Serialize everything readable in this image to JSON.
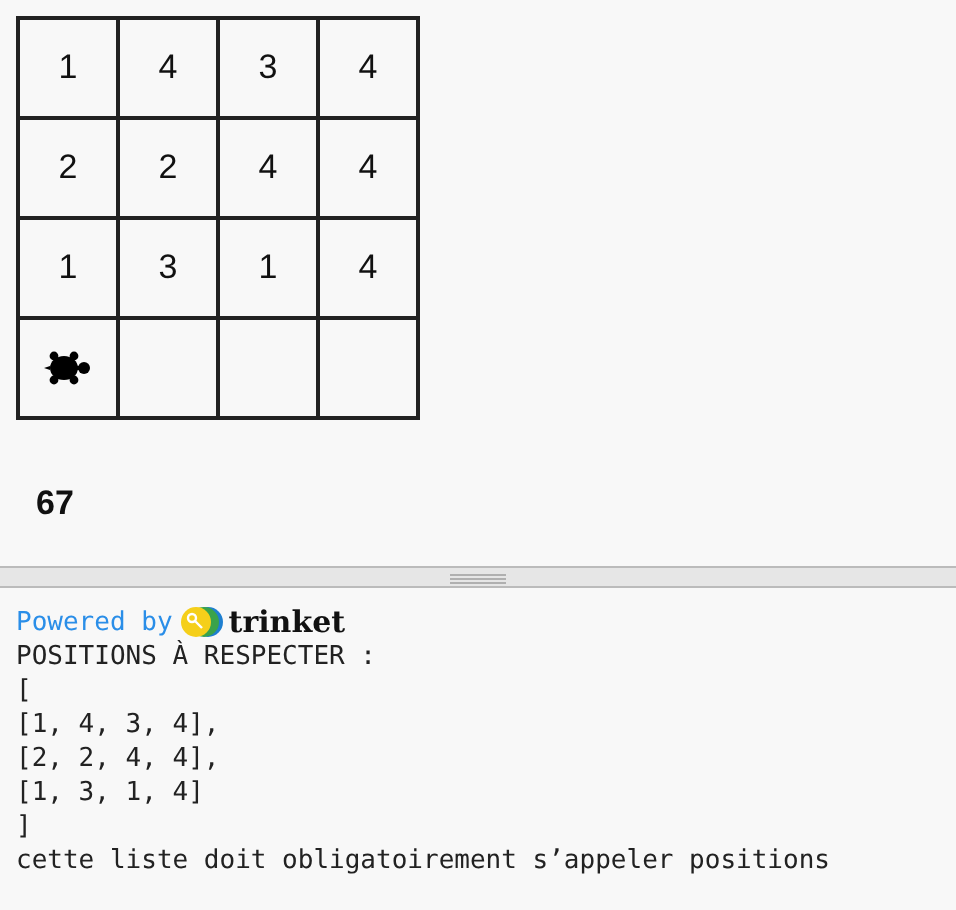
{
  "grid": {
    "rows": [
      [
        {
          "kind": "number",
          "text": "1"
        },
        {
          "kind": "number",
          "text": "4"
        },
        {
          "kind": "number",
          "text": "3"
        },
        {
          "kind": "number",
          "text": "4"
        }
      ],
      [
        {
          "kind": "number",
          "text": "2"
        },
        {
          "kind": "number",
          "text": "2"
        },
        {
          "kind": "number",
          "text": "4"
        },
        {
          "kind": "number",
          "text": "4"
        }
      ],
      [
        {
          "kind": "number",
          "text": "1"
        },
        {
          "kind": "number",
          "text": "3"
        },
        {
          "kind": "number",
          "text": "1"
        },
        {
          "kind": "number",
          "text": "4"
        }
      ],
      [
        {
          "kind": "turtle"
        },
        {
          "kind": "empty"
        },
        {
          "kind": "empty"
        },
        {
          "kind": "empty"
        }
      ]
    ]
  },
  "score": "67",
  "console": {
    "powered_by": "Powered by",
    "brand": "trinket",
    "lines": [
      "POSITIONS À RESPECTER :",
      "[",
      "[1, 4, 3, 4],",
      "[2, 2, 4, 4],",
      "[1, 3, 1, 4]",
      "]",
      "cette liste doit obligatoirement s’appeler positions"
    ]
  }
}
